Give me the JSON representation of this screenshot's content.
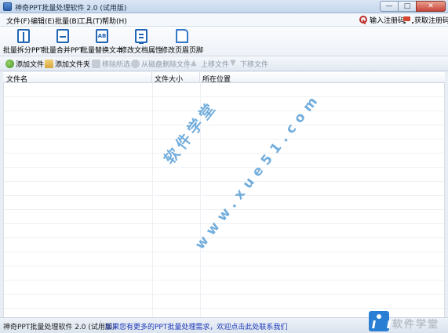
{
  "window": {
    "title": "神奇PPT批量处理软件 2.0 (试用版)",
    "min_glyph": "—",
    "max_glyph": "□",
    "close_glyph": "✕"
  },
  "menu": {
    "items": [
      "文件(F)",
      "编辑(E)",
      "批量(B)",
      "工具(T)",
      "帮助(H)"
    ],
    "register_code": "输入注册码",
    "get_code": "获取注册码"
  },
  "toolbar": {
    "tools": [
      {
        "label": "批量拆分PPT",
        "icon": "split-doc-icon"
      },
      {
        "label": "批量合并PPT",
        "icon": "merge-doc-icon"
      },
      {
        "label": "批量替换文本",
        "icon": "replace-text-icon",
        "glyph": "AB"
      },
      {
        "label": "修改文档属性",
        "icon": "doc-properties-icon"
      },
      {
        "label": "修改页眉页脚",
        "icon": "header-footer-icon"
      }
    ]
  },
  "actions": {
    "add_file": "添加文件",
    "add_folder": "添加文件夹",
    "remove_selected": "移除所选",
    "remove_from_disk": "从磁盘删除文件",
    "move_up": "上移文件",
    "move_down": "下移文件"
  },
  "file_list": {
    "columns": [
      "文件名",
      "文件大小",
      "所在位置"
    ],
    "rows": []
  },
  "watermark": {
    "site_cn": "软件学堂",
    "site_url": "www.xue51.com"
  },
  "status": {
    "app_name": "神奇PPT批量处理软件 2.0 (试用版)",
    "link_text": "如果您有更多的PPT批量处理需求，欢迎点击此处联系我们",
    "corner_brand": "软件学堂"
  },
  "colors": {
    "accent": "#2166b5",
    "link": "#1d38b8",
    "watermark": "#4a96d2"
  }
}
